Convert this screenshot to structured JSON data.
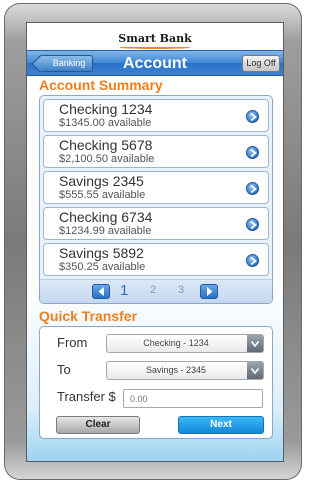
{
  "bank": {
    "name": "Smart Bank"
  },
  "navbar": {
    "back_label": "Banking",
    "title": "Account",
    "logoff_label": "Log Off"
  },
  "account_summary": {
    "title": "Account Summary",
    "accounts": [
      {
        "name": "Checking 1234",
        "available": "$1345.00 available"
      },
      {
        "name": "Checking 5678",
        "available": "$2,100.50 available"
      },
      {
        "name": "Savings 2345",
        "available": "$555.55 available"
      },
      {
        "name": "Checking 6734",
        "available": "$1234.99 available"
      },
      {
        "name": "Savings 5892",
        "available": "$350.25 available"
      }
    ],
    "pager": {
      "pages": [
        "1",
        "2",
        "3"
      ],
      "current": "1"
    }
  },
  "quick_transfer": {
    "title": "Quick Transfer",
    "from_label": "From",
    "from_value": "Checking - 1234",
    "to_label": "To",
    "to_value": "Savings - 2345",
    "amount_label": "Transfer $",
    "amount_placeholder": "0.00",
    "clear_label": "Clear",
    "next_label": "Next"
  },
  "colors": {
    "accent": "#ec7f1c",
    "navbar": "#3f86d6",
    "next_button": "#1488d8"
  },
  "icons": {
    "row_action": "chevron-right-icon",
    "page_prev": "arrow-left-icon",
    "page_next": "arrow-right-icon",
    "dropdown": "chevron-down-icon"
  }
}
